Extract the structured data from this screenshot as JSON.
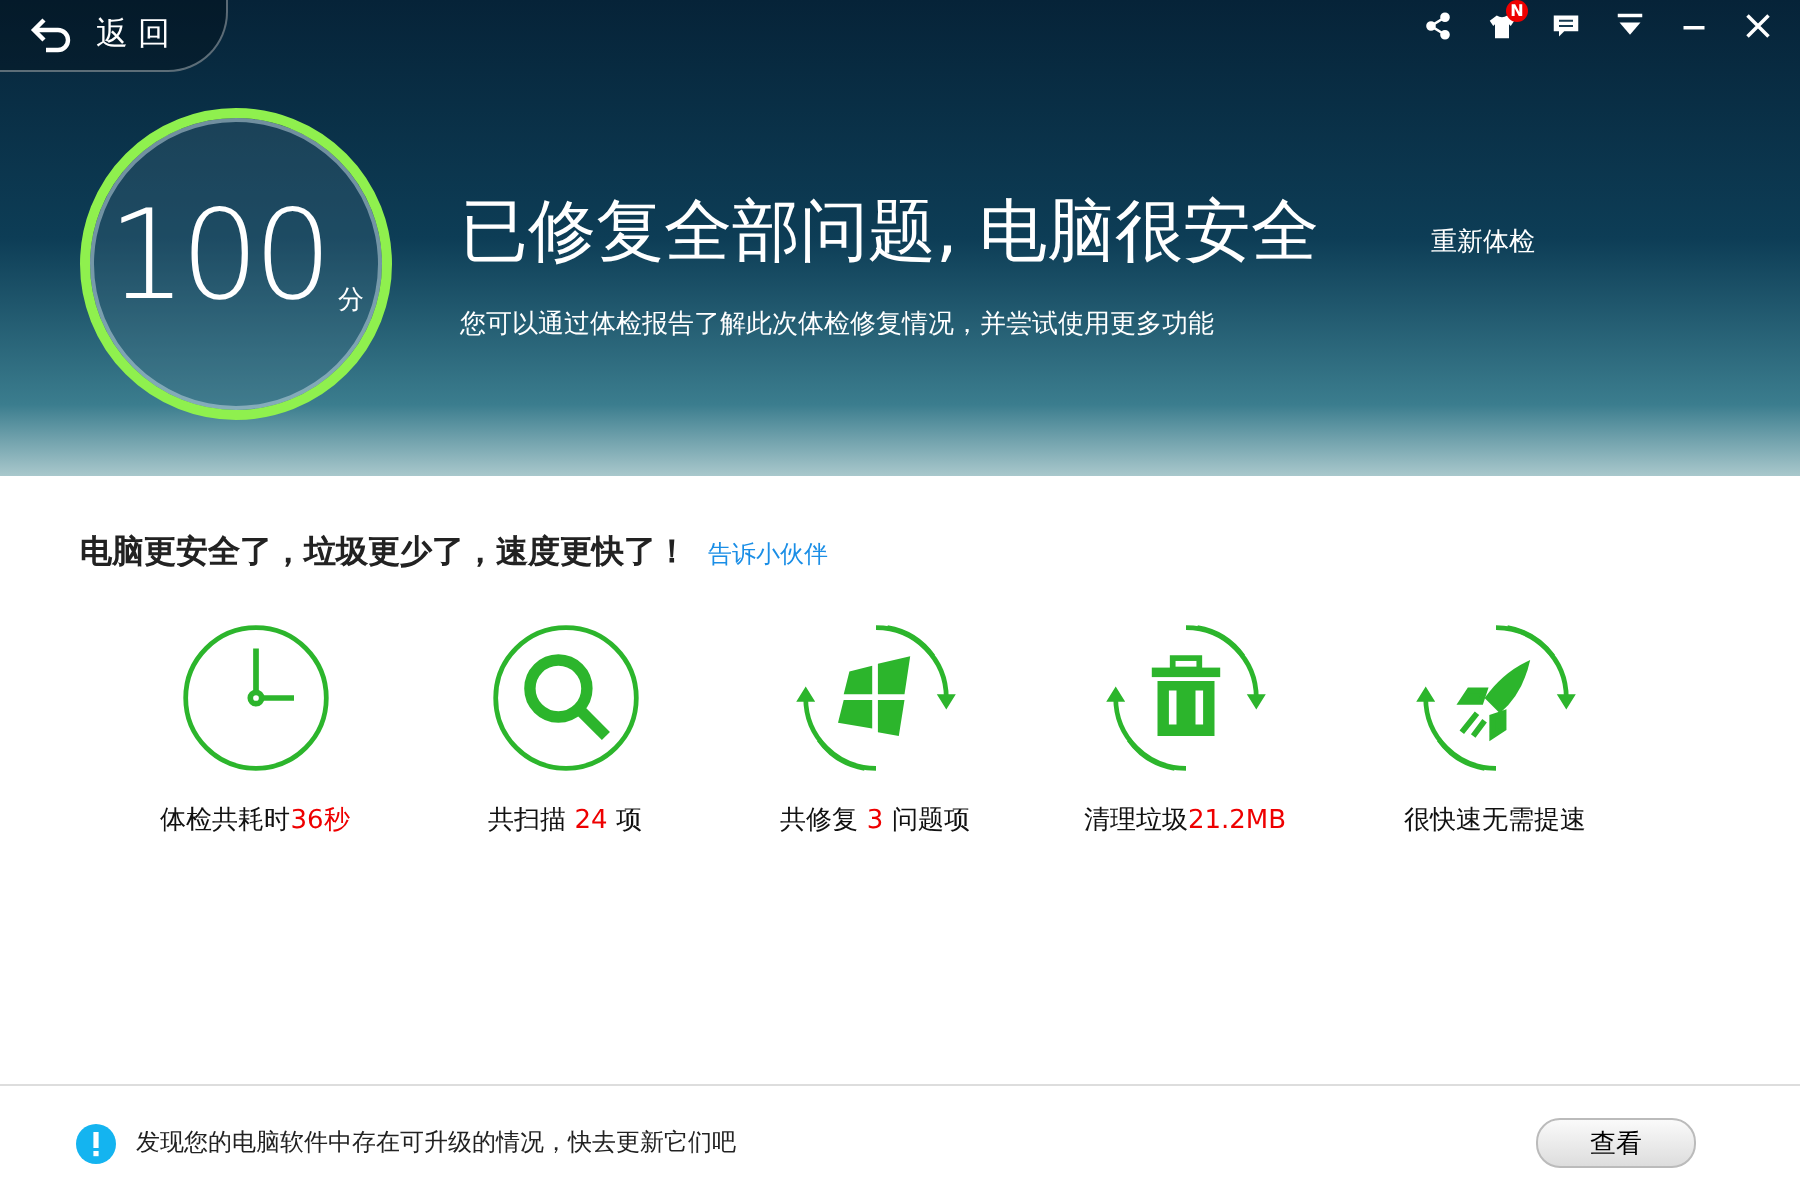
{
  "back_button": {
    "label": "返 回"
  },
  "window_controls": [
    {
      "kind": "share"
    },
    {
      "kind": "skin",
      "badge": "N"
    },
    {
      "kind": "feedback"
    },
    {
      "kind": "menu"
    },
    {
      "kind": "minimize"
    },
    {
      "kind": "close"
    }
  ],
  "score": {
    "value": "100",
    "unit": "分"
  },
  "headline": "已修复全部问题, 电脑很安全",
  "subtitle": "您可以通过体检报告了解此次体检修复情况，并尝试使用更多功能",
  "recheck_link": "重新体检",
  "summary": {
    "text": "电脑更安全了，垃圾更少了，速度更快了！",
    "share_link": "告诉小伙伴"
  },
  "stats": [
    {
      "kind": "clock",
      "prefix": "体检共耗时",
      "value": "36秒"
    },
    {
      "kind": "scan",
      "prefix": "共扫描 ",
      "value": "24",
      "suffix": " 项"
    },
    {
      "kind": "repair",
      "prefix": "共修复 ",
      "value": "3",
      "suffix": " 问题项"
    },
    {
      "kind": "trash",
      "prefix": "清理垃圾",
      "value": "21.2MB"
    },
    {
      "kind": "rocket",
      "prefix": "很快速无需提速"
    }
  ],
  "notice": {
    "text": "发现您的电脑软件中存在可升级的情况，快去更新它们吧",
    "button": "查看"
  }
}
